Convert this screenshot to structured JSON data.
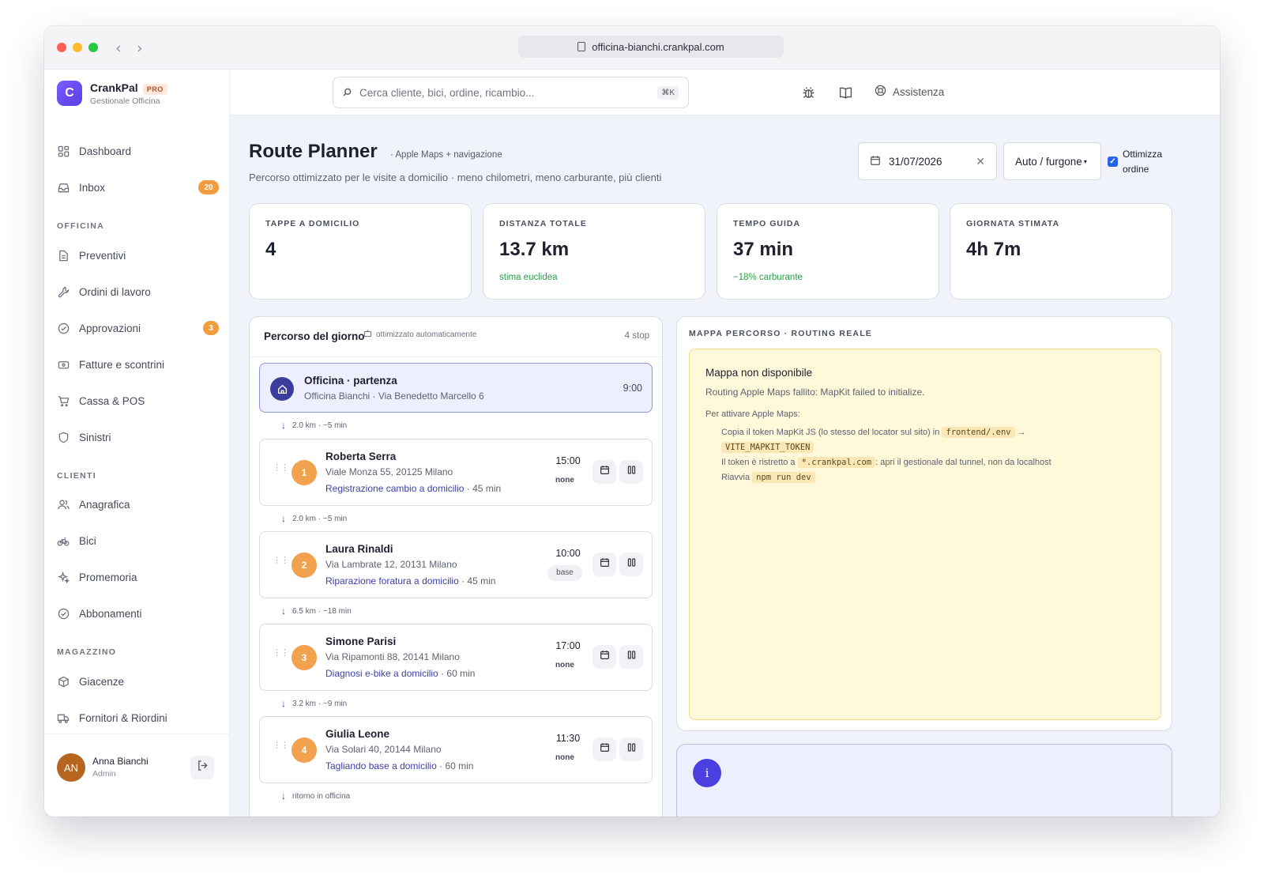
{
  "browser": {
    "url": "officina-bianchi.crankpal.com"
  },
  "brand": {
    "logo_letter": "C",
    "name": "CrankPal",
    "badge": "PRO",
    "subtitle": "Gestionale Officina"
  },
  "sidebar": {
    "top_items": [
      {
        "label": "Dashboard",
        "icon": "grid-icon"
      },
      {
        "label": "Inbox",
        "icon": "inbox-icon",
        "badge": "20"
      }
    ],
    "sections": [
      {
        "title": "OFFICINA",
        "items": [
          {
            "label": "Preventivi",
            "icon": "document-icon"
          },
          {
            "label": "Ordini di lavoro",
            "icon": "wrench-icon"
          },
          {
            "label": "Approvazioni",
            "icon": "check-circle-icon",
            "badge": "3"
          },
          {
            "label": "Fatture e scontrini",
            "icon": "receipt-icon"
          },
          {
            "label": "Cassa & POS",
            "icon": "cart-icon"
          },
          {
            "label": "Sinistri",
            "icon": "shield-icon"
          }
        ]
      },
      {
        "title": "CLIENTI",
        "items": [
          {
            "label": "Anagrafica",
            "icon": "users-icon"
          },
          {
            "label": "Bici",
            "icon": "bike-icon"
          },
          {
            "label": "Promemoria",
            "icon": "sparkle-icon"
          },
          {
            "label": "Abbonamenti",
            "icon": "check-circle-icon"
          }
        ]
      },
      {
        "title": "MAGAZZINO",
        "items": [
          {
            "label": "Giacenze",
            "icon": "box-icon"
          },
          {
            "label": "Fornitori & Riordini",
            "icon": "truck-icon"
          }
        ]
      }
    ],
    "user": {
      "initials": "AN",
      "name": "Anna Bianchi",
      "role": "Admin"
    }
  },
  "topbar": {
    "search_placeholder": "Cerca cliente, bici, ordine, ricambio...",
    "search_shortcut": "⌘K",
    "help_label": "Assistenza"
  },
  "page": {
    "title": "Route Planner",
    "tag": "Apple Maps + navigazione",
    "subtitle": "Percorso ottimizzato per le visite a domicilio · meno chilometri, meno carburante, più clienti",
    "date": "31/07/2026",
    "vehicle": "Auto / furgone",
    "optimize_label_1": "Ottimizza",
    "optimize_label_2": "ordine",
    "optimize_checked": true
  },
  "stats": [
    {
      "label": "TAPPE A DOMICILIO",
      "value": "4",
      "note": ""
    },
    {
      "label": "DISTANZA TOTALE",
      "value": "13.7 km",
      "note": "stima euclidea"
    },
    {
      "label": "TEMPO GUIDA",
      "value": "37 min",
      "note": "−18% carburante"
    },
    {
      "label": "GIORNATA STIMATA",
      "value": "4h 7m",
      "note": ""
    }
  ],
  "route": {
    "title": "Percorso del giorno",
    "auto_label": "ottimizzato automaticamente",
    "count": "4 stop",
    "start": {
      "title": "Officina · partenza",
      "address": "Officina Bianchi · Via Benedetto Marcello 6",
      "time": "9:00"
    },
    "legs": [
      "2.0 km · ~5 min",
      "2.0 km · ~5 min",
      "6.5 km · ~18 min",
      "3.2 km · ~9 min",
      "ritorno in officina"
    ],
    "stops": [
      {
        "n": "1",
        "name": "Roberta Serra",
        "address": "Viale Monza 55, 20125 Milano",
        "job": "Registrazione cambio a domicilio",
        "duration": "· 45 min",
        "time": "15:00",
        "flex": "none"
      },
      {
        "n": "2",
        "name": "Laura Rinaldi",
        "address": "Via Lambrate 12, 20131 Milano",
        "job": "Riparazione foratura a domicilio",
        "duration": "· 45 min",
        "time": "10:00",
        "flex": "base"
      },
      {
        "n": "3",
        "name": "Simone Parisi",
        "address": "Via Ripamonti 88, 20141 Milano",
        "job": "Diagnosi e-bike a domicilio",
        "duration": "· 60 min",
        "time": "17:00",
        "flex": "none"
      },
      {
        "n": "4",
        "name": "Giulia Leone",
        "address": "Via Solari 40, 20144 Milano",
        "job": "Tagliando base a domicilio",
        "duration": "· 60 min",
        "time": "11:30",
        "flex": "none"
      }
    ]
  },
  "map": {
    "label": "MAPPA PERCORSO · ROUTING REALE",
    "error_title": "Mappa non disponibile",
    "error_message": "Routing Apple Maps fallito: MapKit failed to initialize.",
    "help_title": "Per attivare Apple Maps:",
    "step1_a": "Copia il token MapKit JS (lo stesso del locator sul sito) in",
    "step1_code1": "frontend/.env",
    "step1_arrow": "→",
    "step1_code2": "VITE_MAPKIT_TOKEN",
    "step2_a": "Il token è ristretto a",
    "step2_code": "*.crankpal.com",
    "step2_b": ": apri il gestionale dal tunnel, non da localhost",
    "step3_a": "Riavvia",
    "step3_code": "npm run dev"
  },
  "info": {
    "icon": "i"
  },
  "colors": {
    "accent": "#5b3fe0",
    "badge": "#f39c3d",
    "stop_marker": "#f2a24d",
    "link": "#3d40a8",
    "success": "#2e9e4a",
    "warning_bg": "#fff8d9"
  }
}
